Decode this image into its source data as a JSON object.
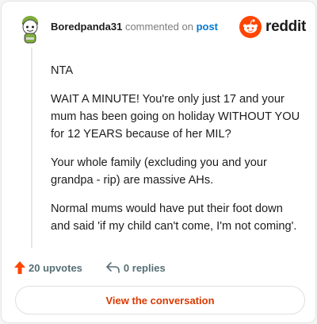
{
  "comment": {
    "username": "Boredpanda31",
    "action_text": "commented on",
    "post_link": "post",
    "brand": "reddit",
    "paragraphs": [
      "NTA",
      "WAIT A MINUTE! You're only just 17 and your mum has been going on holiday WITHOUT YOU for 12 YEARS because of her MIL?",
      "Your whole family (excluding you and your grandpa - rip) are massive AHs.",
      "Normal mums would have put their foot down and said 'if my child can't come, I'm not coming'."
    ]
  },
  "actions": {
    "upvotes_label": "20 upvotes",
    "replies_label": "0 replies"
  },
  "cta": {
    "label": "View the conversation"
  },
  "colors": {
    "brand": "#ff4500",
    "link": "#0079d3",
    "cta_text": "#d93a00",
    "upvote": "#ff4500"
  },
  "icons": [
    "snoo-avatar",
    "reddit-logo",
    "upvote-arrow",
    "reply-arrow"
  ]
}
